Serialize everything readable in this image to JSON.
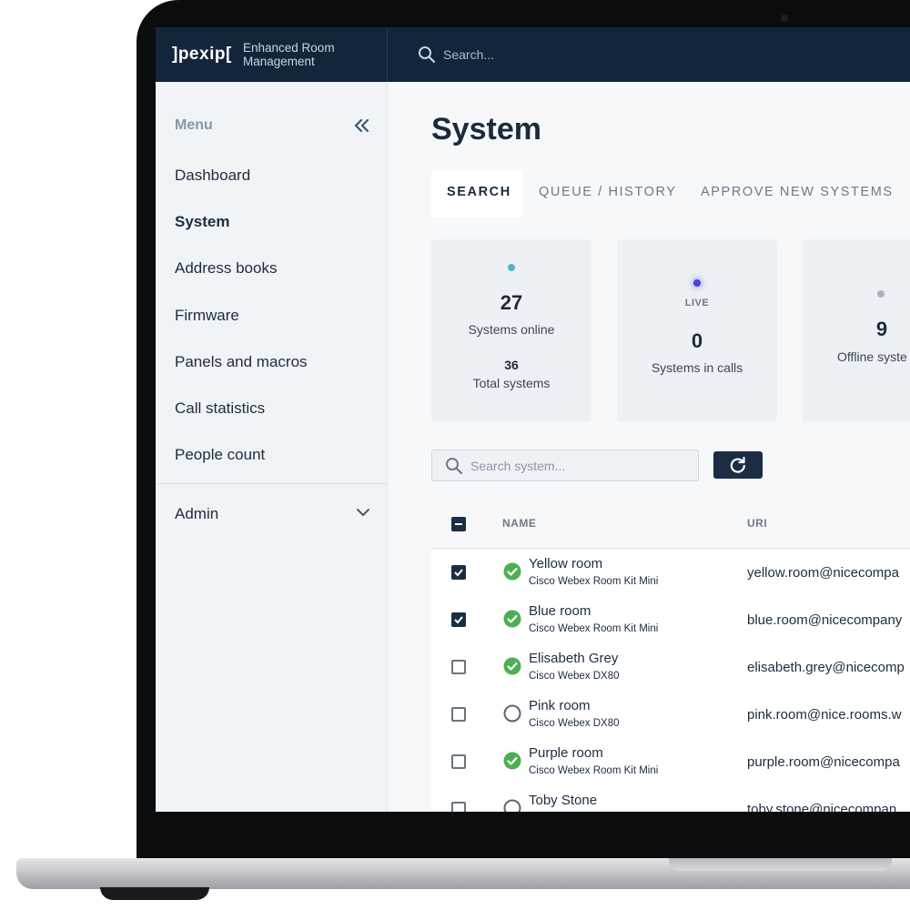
{
  "app": {
    "logo": "]pexip[",
    "name": "Enhanced Room Management"
  },
  "top_search": {
    "placeholder": "Search..."
  },
  "sidebar": {
    "menu_title": "Menu",
    "items": [
      {
        "label": "Dashboard",
        "active": false
      },
      {
        "label": "System",
        "active": true
      },
      {
        "label": "Address books",
        "active": false
      },
      {
        "label": "Firmware",
        "active": false
      },
      {
        "label": "Panels and macros",
        "active": false
      },
      {
        "label": "Call statistics",
        "active": false
      },
      {
        "label": "People count",
        "active": false
      }
    ],
    "admin_label": "Admin"
  },
  "page": {
    "title": "System",
    "tabs": [
      {
        "label": "SEARCH",
        "active": true
      },
      {
        "label": "QUEUE / HISTORY",
        "active": false
      },
      {
        "label": "APPROVE NEW SYSTEMS",
        "active": false
      }
    ]
  },
  "stats": {
    "online": {
      "value": "27",
      "label": "Systems online",
      "total_value": "36",
      "total_label": "Total systems",
      "dot_color": "#4fb6c7"
    },
    "calls": {
      "tag": "LIVE",
      "value": "0",
      "label": "Systems in calls",
      "dot_color": "#4a3fe0"
    },
    "offline": {
      "value": "9",
      "label": "Offline syste",
      "dot_color": "#aab4c0"
    }
  },
  "system_search": {
    "placeholder": "Search system..."
  },
  "table": {
    "columns": [
      "NAME",
      "URI"
    ],
    "rows": [
      {
        "name": "Yellow room",
        "model": "Cisco Webex Room Kit Mini",
        "uri": "yellow.room@nicecompa",
        "checked": true,
        "online": true
      },
      {
        "name": "Blue room",
        "model": "Cisco Webex Room Kit Mini",
        "uri": "blue.room@nicecompany",
        "checked": true,
        "online": true
      },
      {
        "name": "Elisabeth Grey",
        "model": "Cisco Webex DX80",
        "uri": "elisabeth.grey@nicecomp",
        "checked": false,
        "online": true
      },
      {
        "name": "Pink room",
        "model": "Cisco Webex DX80",
        "uri": "pink.room@nice.rooms.w",
        "checked": false,
        "online": false
      },
      {
        "name": "Purple room",
        "model": "Cisco Webex Room Kit Mini",
        "uri": "purple.room@nicecompa",
        "checked": false,
        "online": true
      },
      {
        "name": "Toby Stone",
        "model": "",
        "uri": "toby.stone@nicecompan",
        "checked": false,
        "online": false
      }
    ]
  },
  "colors": {
    "navy": "#13253b",
    "online_green": "#4caf50",
    "accent_dark": "#1b2d44"
  }
}
